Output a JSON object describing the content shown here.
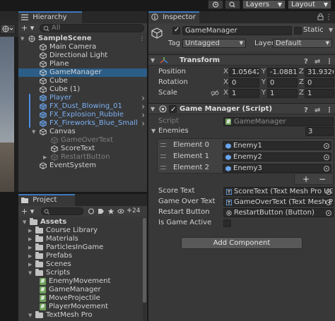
{
  "toolbar": {
    "layers_label": "Layers",
    "layout_label": "Layout"
  },
  "hierarchy": {
    "tab_label": "Hierarchy",
    "search_placeholder": "All",
    "add_label": "+ ▾",
    "items": [
      {
        "label": "SampleScene",
        "kind": "scene"
      },
      {
        "label": "Main Camera",
        "kind": "object"
      },
      {
        "label": "Directional Light",
        "kind": "object"
      },
      {
        "label": "Plane",
        "kind": "object"
      },
      {
        "label": "GameManager",
        "kind": "object",
        "selected": true
      },
      {
        "label": "Cube",
        "kind": "object"
      },
      {
        "label": "Cube (1)",
        "kind": "object"
      },
      {
        "label": "Player",
        "kind": "prefab"
      },
      {
        "label": "FX_Dust_Blowing_01",
        "kind": "prefab"
      },
      {
        "label": "FX_Explosion_Rubble",
        "kind": "prefab"
      },
      {
        "label": "FX_Fireworks_Blue_Small",
        "kind": "prefab"
      },
      {
        "label": "Canvas",
        "kind": "object"
      },
      {
        "label": "GameOverText",
        "kind": "disabled"
      },
      {
        "label": "ScoreText",
        "kind": "object"
      },
      {
        "label": "RestartButton",
        "kind": "disabled"
      },
      {
        "label": "EventSystem",
        "kind": "object"
      }
    ]
  },
  "project": {
    "tab_label": "Project",
    "add_label": "+ ▾",
    "badge_count": "24",
    "items": [
      {
        "label": "Assets",
        "kind": "folder",
        "level": 0
      },
      {
        "label": "Course Library",
        "kind": "folder",
        "level": 1
      },
      {
        "label": "Materials",
        "kind": "folder",
        "level": 1
      },
      {
        "label": "ParticlesInGame",
        "kind": "folder",
        "level": 1
      },
      {
        "label": "Prefabs",
        "kind": "folder",
        "level": 1
      },
      {
        "label": "Scenes",
        "kind": "folder",
        "level": 1
      },
      {
        "label": "Scripts",
        "kind": "folder",
        "level": 1
      },
      {
        "label": "EnemyMovement",
        "kind": "script",
        "level": 2
      },
      {
        "label": "GameManager",
        "kind": "script",
        "level": 2
      },
      {
        "label": "MoveProjectile",
        "kind": "script",
        "level": 2
      },
      {
        "label": "PlayerMovement",
        "kind": "script",
        "level": 2
      },
      {
        "label": "TextMesh Pro",
        "kind": "folder",
        "level": 1
      }
    ]
  },
  "inspector": {
    "tab_label": "Inspector",
    "object_name": "GameManager",
    "static_label": "Static",
    "tag_label": "Tag",
    "tag_value": "Untagged",
    "layer_label": "Layer",
    "layer_value": "Default",
    "transform": {
      "title": "Transform",
      "position_label": "Position",
      "rotation_label": "Rotation",
      "scale_label": "Scale",
      "axis_x": "X",
      "axis_y": "Y",
      "axis_z": "Z",
      "position": [
        "1.05642",
        "-1.08816",
        "31.9326"
      ],
      "rotation": [
        "0",
        "0",
        "0"
      ],
      "scale": [
        "1",
        "1",
        "1"
      ]
    },
    "script_component": {
      "title": "Game Manager (Script)",
      "script_label": "Script",
      "script_value": "GameManager",
      "enemies_label": "Enemies",
      "enemies_count": "3",
      "elements": [
        {
          "label": "Element 0",
          "value": "Enemy1"
        },
        {
          "label": "Element 1",
          "value": "Enemy2"
        },
        {
          "label": "Element 2",
          "value": "Enemy3"
        }
      ],
      "add_remove": [
        "+",
        "−"
      ],
      "fields": [
        {
          "label": "Score Text",
          "value": "ScoreText (Text Mesh Pro UG"
        },
        {
          "label": "Game Over Text",
          "value": "GameOverText (Text Mesh Pro"
        },
        {
          "label": "Restart Button",
          "value": "RestartButton (Button)"
        },
        {
          "label": "Is Game Active",
          "value": ""
        }
      ]
    },
    "add_component_label": "Add Component"
  },
  "colors": {
    "selection": "#2c5d87",
    "prefab_text": "#7cb0f2",
    "tab_accent": "#3a79bb",
    "panel_bg": "#383838"
  }
}
